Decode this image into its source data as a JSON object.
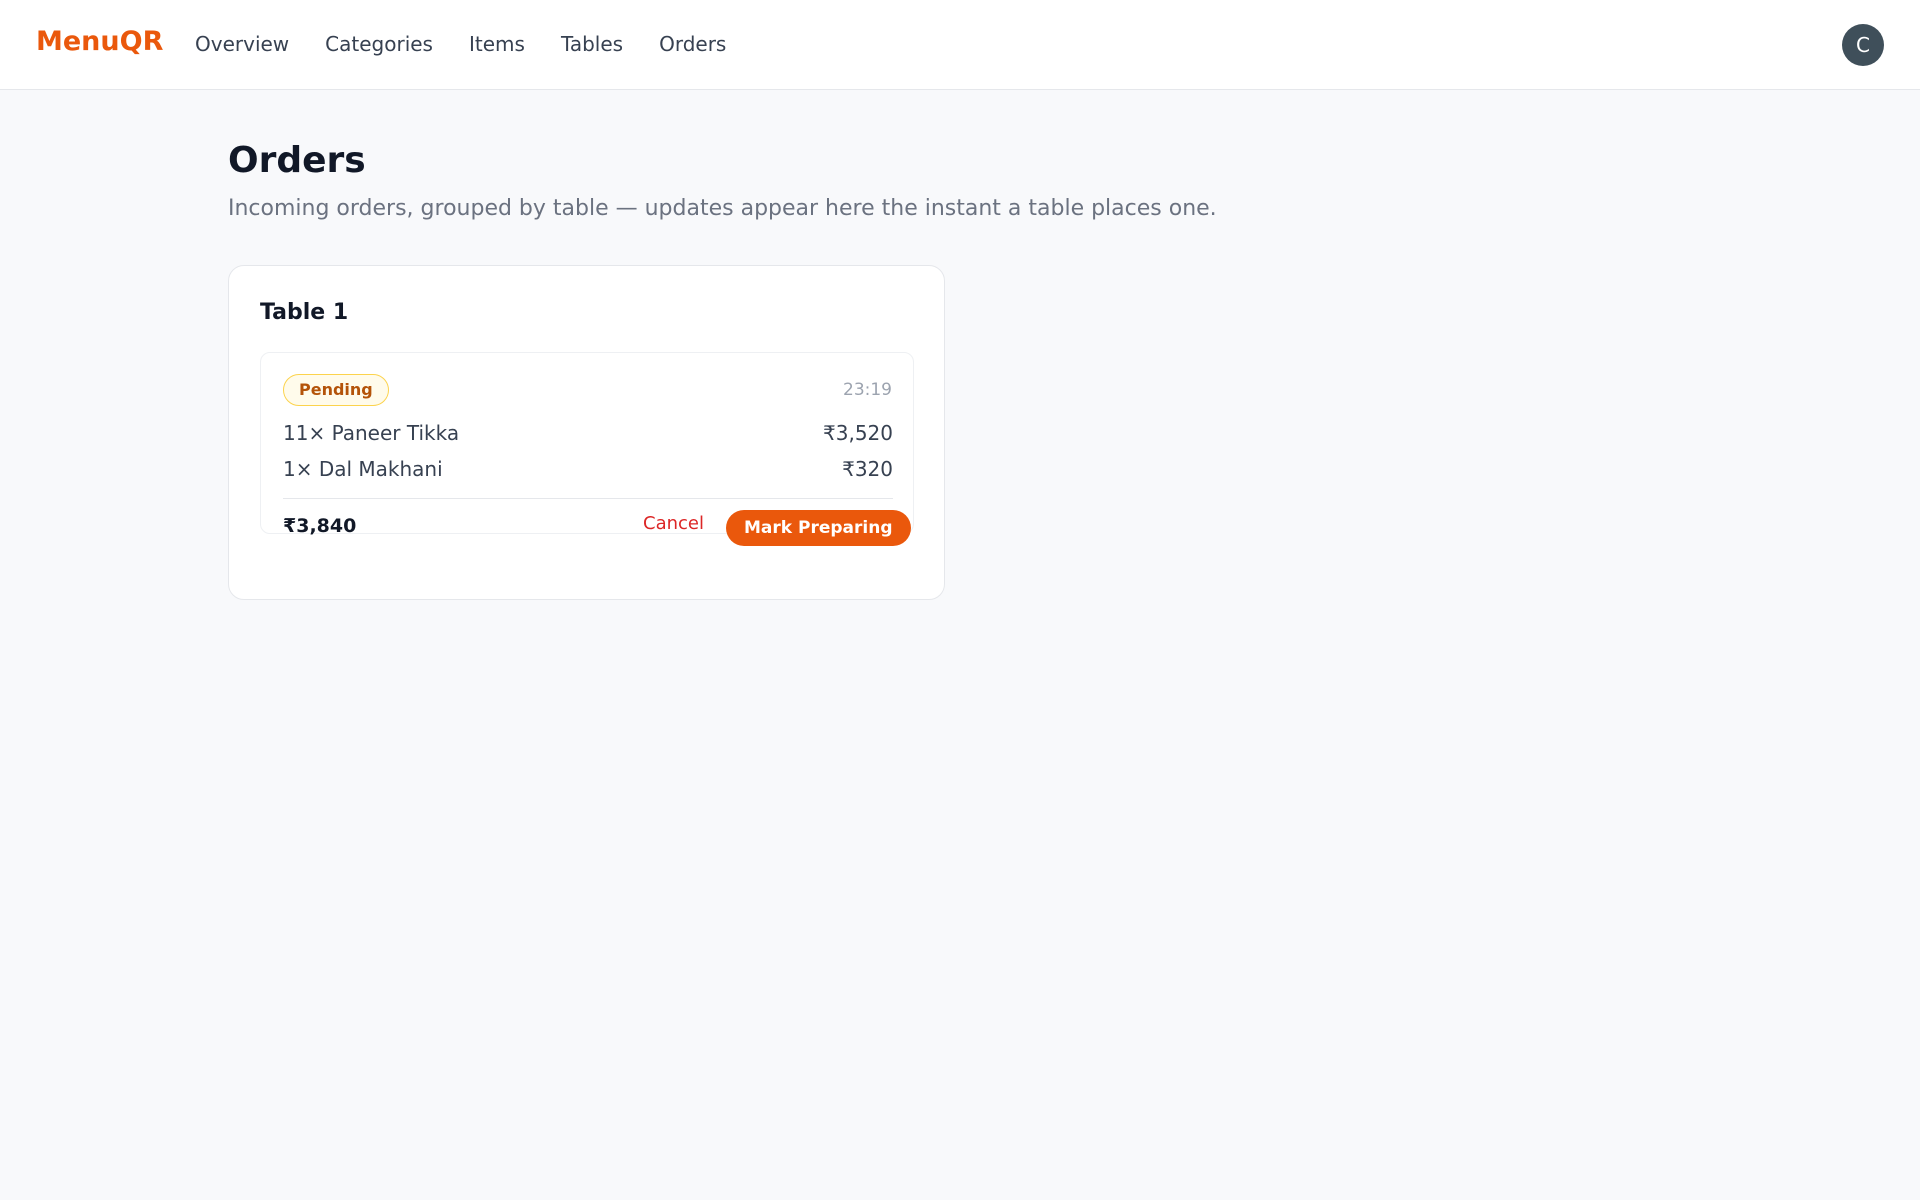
{
  "header": {
    "brand": "MenuQR",
    "nav": [
      {
        "label": "Overview"
      },
      {
        "label": "Categories"
      },
      {
        "label": "Items"
      },
      {
        "label": "Tables"
      },
      {
        "label": "Orders"
      }
    ],
    "avatar_initial": "C"
  },
  "page": {
    "title": "Orders",
    "subtitle": "Incoming orders, grouped by table — updates appear here the instant a table places one."
  },
  "tables": [
    {
      "name": "Table 1",
      "orders": [
        {
          "status": "Pending",
          "time": "23:19",
          "items": [
            {
              "name": "11× Paneer Tikka",
              "price": "₹3,520"
            },
            {
              "name": "1× Dal Makhani",
              "price": "₹320"
            }
          ],
          "total": "₹3,840",
          "cancel_label": "Cancel",
          "action_label": "Mark Preparing"
        }
      ]
    }
  ],
  "colors": {
    "accent": "#ea580c",
    "pending_text": "#b45309",
    "pending_border": "#fcd34d",
    "danger": "#dc2626",
    "avatar_bg": "#3f4f5a"
  }
}
